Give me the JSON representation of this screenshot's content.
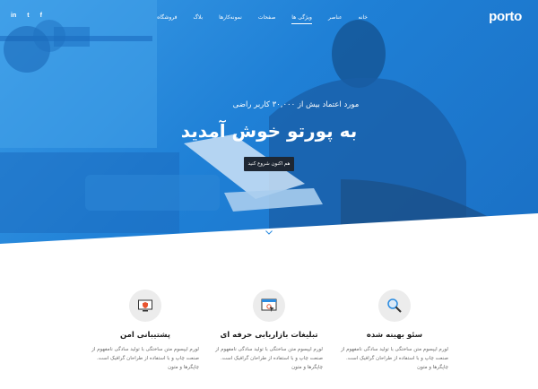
{
  "brand": {
    "logo": "porto"
  },
  "nav": {
    "items": [
      {
        "label": "خانه",
        "active": false
      },
      {
        "label": "عناصر",
        "active": false
      },
      {
        "label": "ویژگی ها",
        "active": true
      },
      {
        "label": "صفحات",
        "active": false
      },
      {
        "label": "نمونه‌کارها",
        "active": false
      },
      {
        "label": "بلاگ",
        "active": false
      },
      {
        "label": "فروشگاه",
        "active": false
      }
    ]
  },
  "social": {
    "linkedin": "in",
    "twitter": "t",
    "facebook": "f"
  },
  "hero": {
    "subtitle": "مورد اعتماد بیش از ۳۰,۰۰۰ کاربر راضی",
    "title": "به پورتو خوش آمدید",
    "button": "هم اکنون شروع کنید"
  },
  "features": [
    {
      "title": "سئو بهینه شده",
      "text": "لورم ایپسوم متن ساختگی با تولید سادگی نامفهوم از صنعت چاپ و با استفاده از طراحان گرافیک است. چاپگرها و متون",
      "icon": "magnifier-icon"
    },
    {
      "title": "تبلیغات بازاریابی حرفه ای",
      "text": "لورم ایپسوم متن ساختگی با تولید سادگی نامفهوم از صنعت چاپ و با استفاده از طراحان گرافیک است. چاپگرها و متون",
      "icon": "browser-cursor-icon"
    },
    {
      "title": "پشتیبانی امن",
      "text": "لورم ایپسوم متن ساختگی با تولید سادگی نامفهوم از صنعت چاپ و با استفاده از طراحان گرافیک است. چاپگرها و متون",
      "icon": "secure-screen-icon"
    }
  ],
  "colors": {
    "hero_blue": "#2a8be0",
    "button_dark": "#1e2733",
    "icon_circle": "#ececec"
  }
}
